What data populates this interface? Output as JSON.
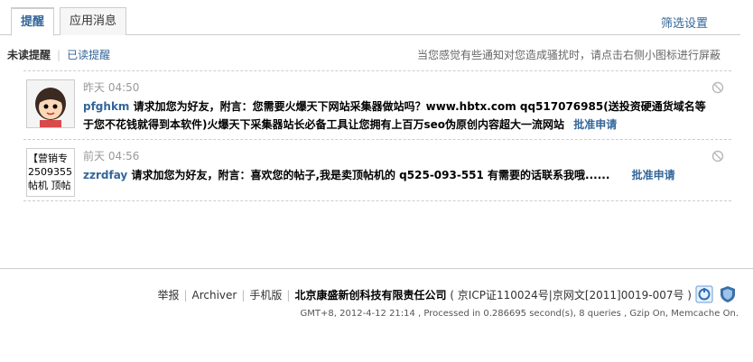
{
  "tabs": [
    {
      "label": "提醒"
    },
    {
      "label": "应用消息"
    }
  ],
  "filter_settings": "筛选设置",
  "subnav": {
    "unread": "未读提醒",
    "read": "已读提醒",
    "tip": "当您感觉有些通知对您造成骚扰时，请点击右侧小图标进行屏蔽"
  },
  "notices": [
    {
      "time": "昨天 04:50",
      "user": "pfghkm",
      "message": "请求加您为好友，附言：您需要火爆天下网站采集器做站吗？www.hbtx.com qq517076985(送投资硬通货域名等于您不花钱就得到本软件)火爆天下采集器站长必备工具让您拥有上百万seo伪原创内容超大一流网站",
      "approve": "批准申请",
      "avatar_icon": "user-avatar-cartoon-icon"
    },
    {
      "time": "前天 04:56",
      "user": "zzrdfay",
      "message": "请求加您为好友，附言：喜欢您的帖子,我是卖顶帖机的 q525-093-551 有需要的话联系我哦......",
      "approve": "批准申请",
      "avatar_lines": [
        "【营销专",
        "2509355",
        "帖机 顶帖"
      ]
    }
  ],
  "footer": {
    "links": [
      "举报",
      "Archiver",
      "手机版"
    ],
    "company": "北京康盛新创科技有限责任公司",
    "icp": "( 京ICP证110024号|京网文[2011]0019-007号 )",
    "stats": "GMT+8, 2012-4-12 21:14 , Processed in 0.286695 second(s), 8 queries , Gzip On, Memcache On."
  },
  "colors": {
    "link": "#336699",
    "border": "#cdcdcd"
  }
}
